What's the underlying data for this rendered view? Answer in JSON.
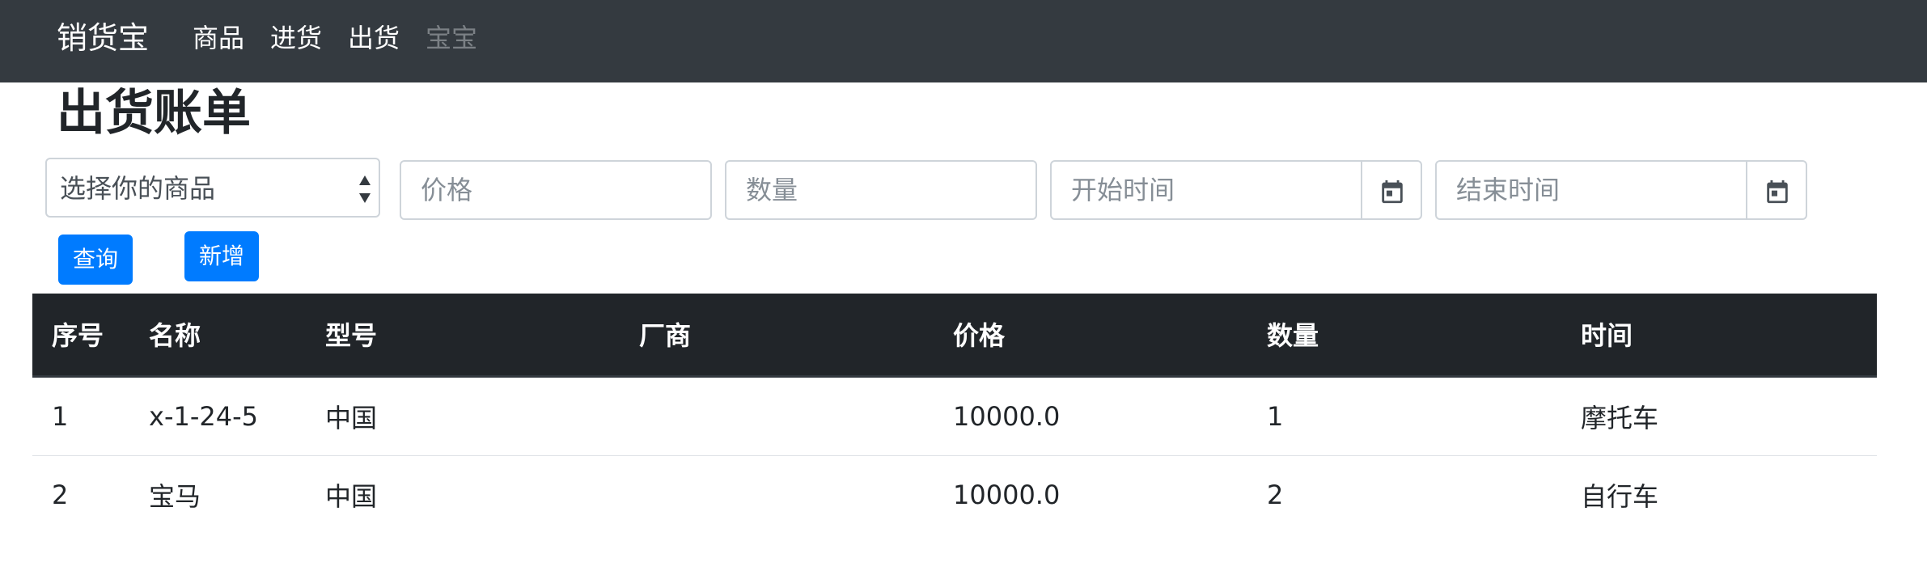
{
  "navbar": {
    "brand": "销货宝",
    "links": [
      {
        "label": "商品",
        "disabled": false
      },
      {
        "label": "进货",
        "disabled": false
      },
      {
        "label": "出货",
        "disabled": false
      },
      {
        "label": "宝宝",
        "disabled": true
      }
    ]
  },
  "page": {
    "title": "出货账单"
  },
  "form": {
    "product_select": "选择你的商品",
    "price_placeholder": "价格",
    "quantity_placeholder": "数量",
    "start_time_placeholder": "开始时间",
    "end_time_placeholder": "结束时间",
    "query_label": "查询",
    "add_label": "新增"
  },
  "table": {
    "headers": [
      "序号",
      "名称",
      "型号",
      "厂商",
      "价格",
      "数量",
      "时间"
    ],
    "rows": [
      [
        "1",
        "x-1-24-5",
        "中国",
        "",
        "10000.0",
        "1",
        "摩托车"
      ],
      [
        "2",
        "宝马",
        "中国",
        "",
        "10000.0",
        "2",
        "自行车"
      ]
    ]
  },
  "colors": {
    "navbar_bg": "#343a40",
    "primary": "#007bff",
    "table_header_bg": "#212529"
  },
  "icons": {
    "calendar": "calendar-icon",
    "select_arrows": "select-arrows-icon"
  }
}
